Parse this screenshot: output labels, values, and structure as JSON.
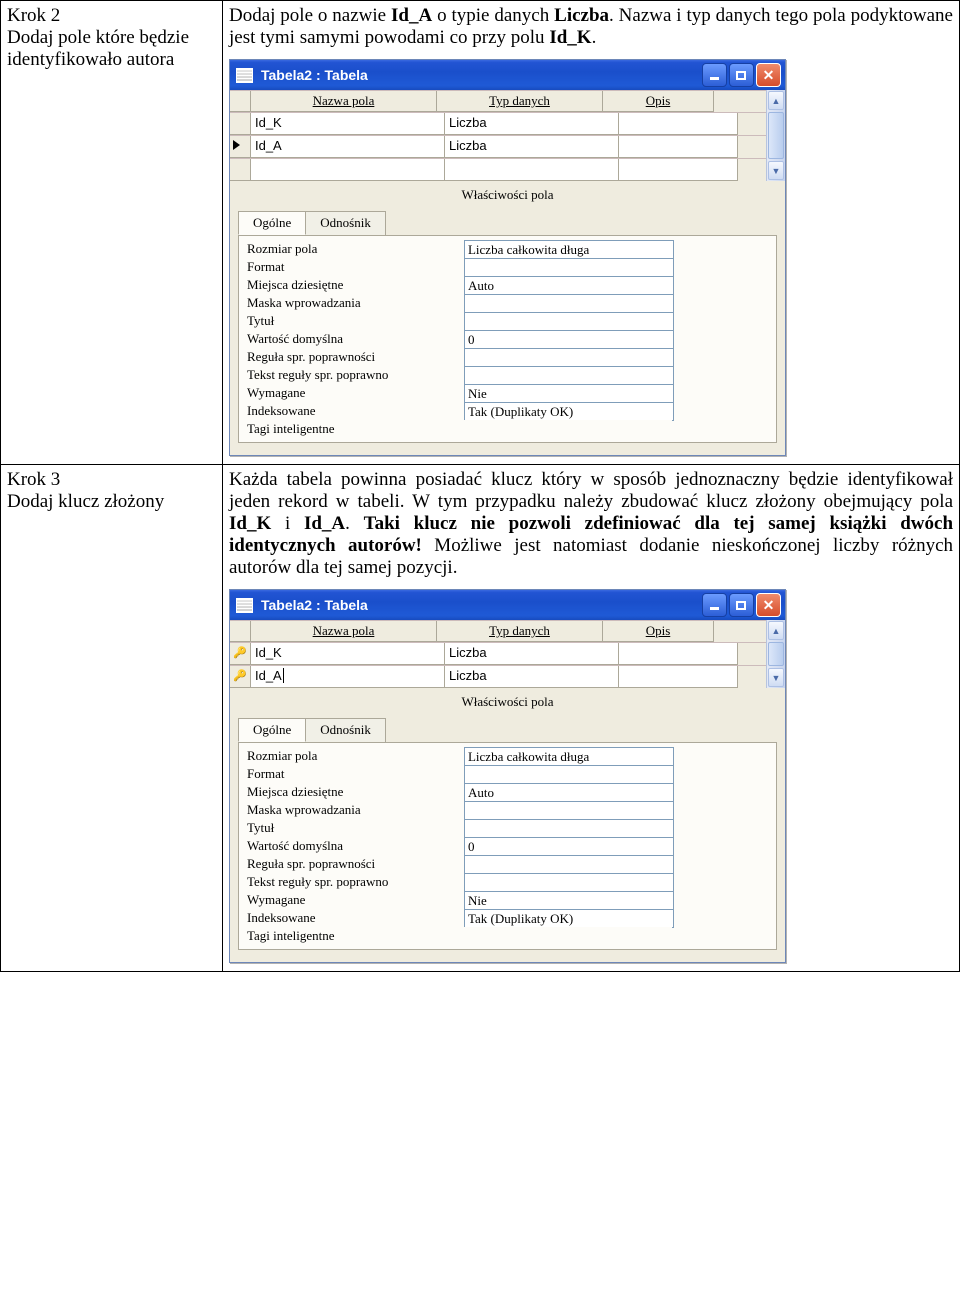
{
  "steps": [
    {
      "id": "k2",
      "title": "Krok 2",
      "subtitle": "Dodaj pole które będzie identyfikowało autora",
      "text_parts": [
        "Dodaj pole o nazwie ",
        "Id_A",
        " o typie danych ",
        "Liczba",
        ". Nazwa i typ danych tego pola podyktowane jest tymi samymi powodami co przy polu ",
        "Id_K",
        "."
      ]
    },
    {
      "id": "k3",
      "title": "Krok 3",
      "subtitle": "Dodaj klucz złożony",
      "text_parts": [
        "Każda tabela powinna posiadać klucz który w sposób jednoznaczny będzie identyfikował jeden rekord w tabeli. W tym przypadku należy zbudować klucz złożony obejmujący pola ",
        "Id_K",
        " i ",
        "Id_A",
        ". ",
        "Taki klucz nie pozwoli zdefiniować dla tej samej książki dwóch identycznych autorów!",
        " Możliwe jest natomiast dodanie nieskończonej liczby różnych autorów dla tej samej pozycji."
      ]
    }
  ],
  "windows": {
    "title": "Tabela2 : Tabela",
    "cols": [
      "Nazwa pola",
      "Typ danych",
      "Opis"
    ],
    "rows_a": [
      {
        "sel": "",
        "name": "Id_K",
        "type": "Liczba"
      },
      {
        "sel": "►",
        "name": "Id_A",
        "type": "Liczba"
      }
    ],
    "rows_b": [
      {
        "sel": "🔑",
        "name": "Id_K",
        "type": "Liczba"
      },
      {
        "sel": "🔑►",
        "name": "Id_A",
        "type": "Liczba",
        "cursor": true
      }
    ],
    "section_label": "Właściwości pola",
    "tabs": [
      "Ogólne",
      "Odnośnik"
    ],
    "props": [
      {
        "l": "Rozmiar pola",
        "v": "Liczba całkowita długa"
      },
      {
        "l": "Format",
        "v": ""
      },
      {
        "l": "Miejsca dziesiętne",
        "v": "Auto"
      },
      {
        "l": "Maska wprowadzania",
        "v": ""
      },
      {
        "l": "Tytuł",
        "v": ""
      },
      {
        "l": "Wartość domyślna",
        "v": "0"
      },
      {
        "l": "Reguła spr. poprawności",
        "v": ""
      },
      {
        "l": "Tekst reguły spr. poprawno",
        "v": ""
      },
      {
        "l": "Wymagane",
        "v": "Nie"
      },
      {
        "l": "Indeksowane",
        "v": "Tak (Duplikaty OK)"
      },
      {
        "l": "Tagi inteligentne",
        "noval": true
      }
    ]
  }
}
